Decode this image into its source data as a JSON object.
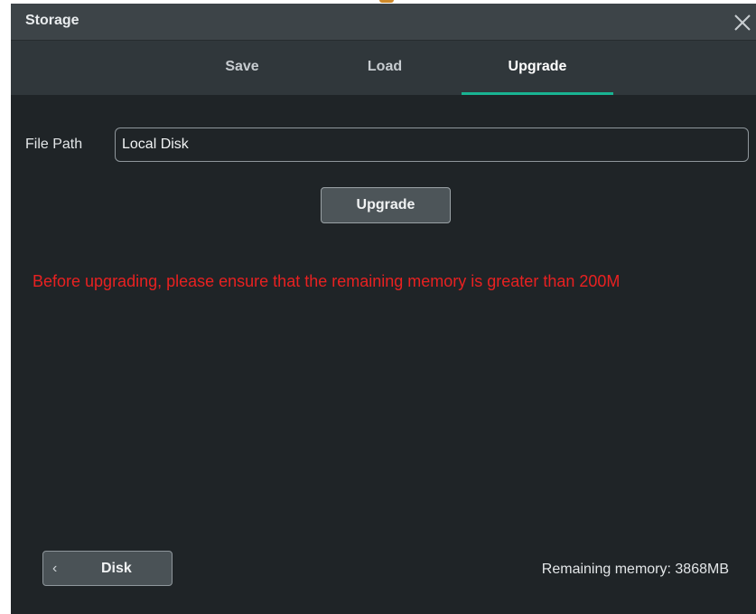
{
  "window": {
    "title": "Storage",
    "close_icon": "close-icon"
  },
  "tabs": [
    {
      "label": "Save",
      "active": false
    },
    {
      "label": "Load",
      "active": false
    },
    {
      "label": "Upgrade",
      "active": true
    }
  ],
  "form": {
    "file_path_label": "File Path",
    "file_path_value": "Local Disk",
    "upgrade_button": "Upgrade"
  },
  "warning": "Before upgrading, please ensure that the remaining memory is greater than 200M",
  "footer": {
    "disk_button": "Disk",
    "back_icon": "chevron-left-icon",
    "remaining_memory": "Remaining memory: 3868MB"
  },
  "colors": {
    "accent": "#19b392",
    "warning": "#e82121",
    "background": "#1f2427"
  }
}
